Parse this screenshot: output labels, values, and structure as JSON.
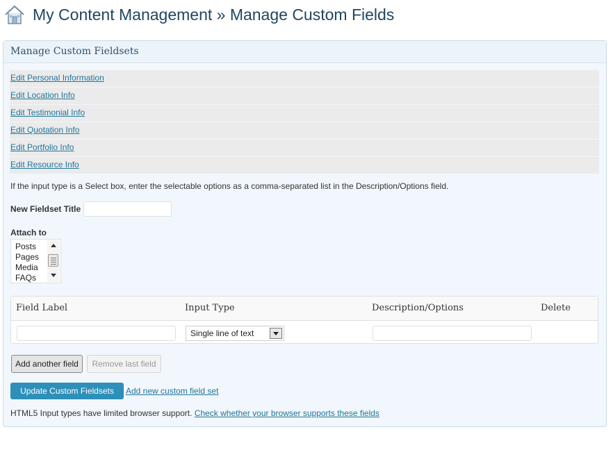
{
  "page": {
    "title": "My Content Management » Manage Custom Fields",
    "icon": "home-icon"
  },
  "panel": {
    "title": "Manage Custom Fieldsets",
    "fieldsets": [
      {
        "label": "Edit Personal Information"
      },
      {
        "label": "Edit Location Info"
      },
      {
        "label": "Edit Testimonial Info"
      },
      {
        "label": "Edit Quotation Info"
      },
      {
        "label": "Edit Portfolio Info"
      },
      {
        "label": "Edit Resource Info"
      }
    ],
    "note": "If the input type is a Select box, enter the selectable options as a comma-separated list in the Description/Options field.",
    "new_title_label": "New Fieldset Title",
    "new_title_value": "",
    "attach_label": "Attach to",
    "attach_options": [
      "Posts",
      "Pages",
      "Media",
      "FAQs"
    ]
  },
  "fields_table": {
    "headers": [
      "Field Label",
      "Input Type",
      "Description/Options",
      "Delete"
    ],
    "row": {
      "field_label": "",
      "input_type": "Single line of text",
      "description": ""
    }
  },
  "buttons": {
    "add_field": "Add another field",
    "remove_field": "Remove last field",
    "update": "Update Custom Fieldsets",
    "add_new_set": "Add new custom field set"
  },
  "footer": {
    "text": "HTML5 Input types have limited browser support.",
    "link": "Check whether your browser supports these fields"
  },
  "colors": {
    "link": "#21759b",
    "primary_button": "#2e8fb9",
    "title": "#21465f"
  }
}
